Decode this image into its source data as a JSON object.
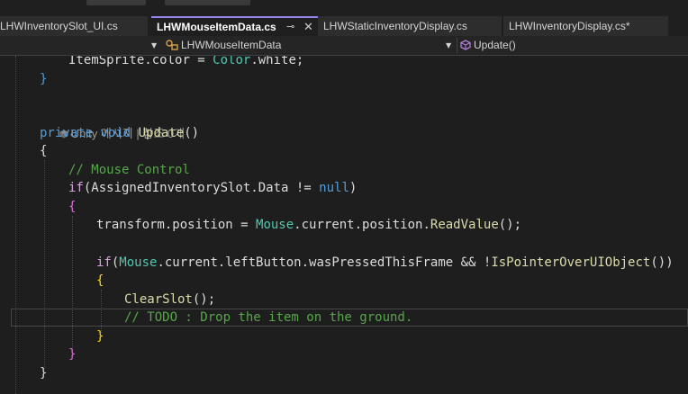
{
  "tabs": [
    {
      "label": "LHWInventorySlot_UI.cs",
      "active": false
    },
    {
      "label": "LHWMouseItemData.cs",
      "active": true
    },
    {
      "label": "LHWStaticInventoryDisplay.cs",
      "active": false
    },
    {
      "label": "LHWInventoryDisplay.cs*",
      "active": false
    }
  ],
  "tab_pin_glyph": "⊸",
  "tab_close_glyph": "✕",
  "navbar": {
    "class_name": "LHWMouseItemData",
    "member_name": "Update()"
  },
  "codelens": "Unity 메시지 | 참조 0개",
  "code": {
    "l0": {
      "a": "ItemSprite",
      "b": ".color = ",
      "c": "Color",
      "d": ".white;"
    },
    "l1": "}",
    "l3a": "private",
    "l3b": "void",
    "l3c": "Update",
    "l3d": "()",
    "l4": "{",
    "l5": "// Mouse Control",
    "l6a": "if",
    "l6b": "(AssignedInventorySlot.Data != ",
    "l6c": "null",
    "l6d": ")",
    "l7": "{",
    "l8a": "transform",
    "l8b": ".position = ",
    "l8c": "Mouse",
    "l8d": ".current.position.",
    "l8e": "ReadValue",
    "l8f": "();",
    "l10a": "if",
    "l10b": "(",
    "l10c": "Mouse",
    "l10d": ".current.leftButton.wasPressedThisFrame && !",
    "l10e": "IsPointerOverUIObject",
    "l10f": "())",
    "l11": "{",
    "l12a": "ClearSlot",
    "l12b": "();",
    "l13": "// TODO : Drop the item on the ground.",
    "l14": "}",
    "l15": "}",
    "l16": "}"
  },
  "colors": {
    "keyword": "#569cd6",
    "control": "#d8a0df",
    "type": "#4ec9b0",
    "method": "#dcdcaa",
    "comment": "#57a64a",
    "active_tab_accent": "#9184ee"
  }
}
